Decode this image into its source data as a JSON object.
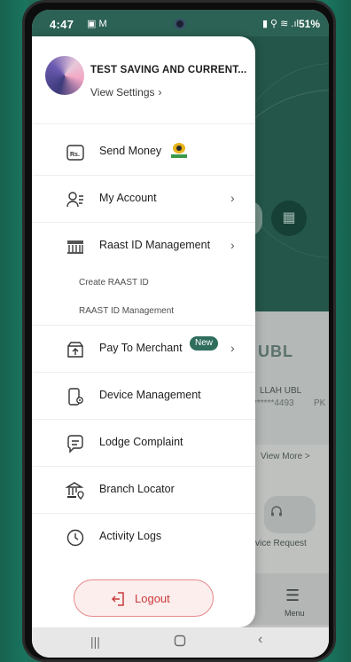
{
  "status_bar": {
    "time": "4:47",
    "battery": "51%"
  },
  "drawer": {
    "profile": {
      "name": "TEST SAVING AND CURRENT...",
      "view_settings": "View Settings"
    },
    "items": [
      {
        "label": "Send Money",
        "icon": "rupee-card-icon"
      },
      {
        "label": "My Account",
        "icon": "user-list-icon",
        "chevron": true
      },
      {
        "label": "Raast ID Management",
        "icon": "bank-icon",
        "chevron": true
      },
      {
        "label": "Pay To Merchant",
        "icon": "merchant-box-icon",
        "chevron": true,
        "badge": "New"
      },
      {
        "label": "Device Management",
        "icon": "device-gear-icon"
      },
      {
        "label": "Lodge Complaint",
        "icon": "complaint-chat-icon"
      },
      {
        "label": "Branch Locator",
        "icon": "branch-pin-icon"
      },
      {
        "label": "Activity Logs",
        "icon": "clock-icon"
      }
    ],
    "sub_items": [
      {
        "label": "Create RAAST ID"
      },
      {
        "label": "RAAST ID Management"
      }
    ],
    "logout_label": "Logout"
  },
  "background": {
    "bank_logo": "UBL",
    "account_name": "LLAH UBL",
    "account_number": "******4493",
    "currency": "PK",
    "view_more": "View More >",
    "device_request": "vice Request",
    "menu_label": "Menu"
  },
  "colors": {
    "accent_green": "#2f6e5d",
    "logout_red": "#c93a3a",
    "logout_bg": "#fdeeee"
  }
}
